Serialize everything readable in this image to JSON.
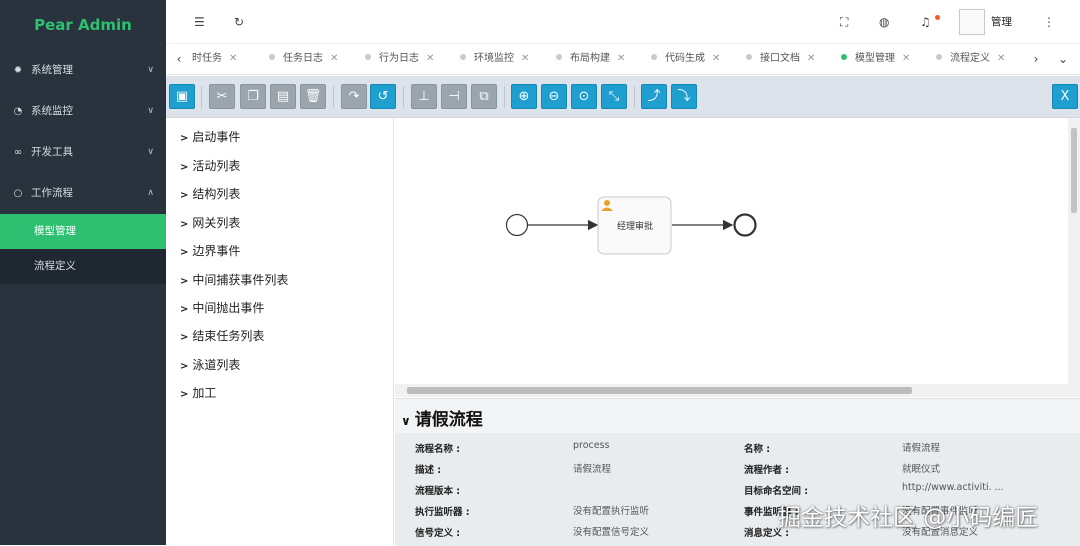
{
  "app": {
    "title": "Pear Admin",
    "accent": "#2fbf70",
    "sidebar_bg": "#28333e"
  },
  "sidebar": {
    "items": [
      {
        "label": "系统管理",
        "icon": "gear-icon",
        "expanded": false
      },
      {
        "label": "系统监控",
        "icon": "gauge-icon",
        "expanded": false
      },
      {
        "label": "开发工具",
        "icon": "link-icon",
        "expanded": false
      },
      {
        "label": "工作流程",
        "icon": "circle-icon",
        "expanded": true
      }
    ],
    "sub_items": [
      {
        "label": "模型管理",
        "active": true
      },
      {
        "label": "流程定义",
        "active": false
      }
    ]
  },
  "header": {
    "menu_icon": "menu-fold-icon",
    "refresh_icon": "refresh-icon",
    "fullscreen_icon": "fullscreen-icon",
    "globe_icon": "globe-icon",
    "bell_icon": "bell-icon",
    "user_name": "管理",
    "more_icon": "more-vertical-icon"
  },
  "tabs": [
    {
      "label": "时任务",
      "active": false
    },
    {
      "label": "任务日志",
      "active": false
    },
    {
      "label": "行为日志",
      "active": false
    },
    {
      "label": "环境监控",
      "active": false
    },
    {
      "label": "布局构建",
      "active": false
    },
    {
      "label": "代码生成",
      "active": false
    },
    {
      "label": "接口文档",
      "active": false
    },
    {
      "label": "模型管理",
      "active": true
    },
    {
      "label": "流程定义",
      "active": false
    }
  ],
  "toolbar": {
    "buttons": [
      "save",
      "cut",
      "copy",
      "paste",
      "delete",
      "redo",
      "undo",
      "align-vertical",
      "align-horizontal",
      "same-size",
      "zoom-in",
      "zoom-out",
      "zoom-actual",
      "zoom-fit",
      "bend-add",
      "bend-remove"
    ],
    "close_label": "X"
  },
  "palette": {
    "items": [
      "启动事件",
      "活动列表",
      "结构列表",
      "网关列表",
      "边界事件",
      "中间捕获事件列表",
      "中间抛出事件",
      "结束任务列表",
      "泳道列表",
      "加工"
    ]
  },
  "diagram": {
    "task_label": "经理审批",
    "task_icon": "user-icon"
  },
  "properties": {
    "title": "请假流程",
    "rows": [
      {
        "label": "流程名称 :",
        "value": "process"
      },
      {
        "label": "名称 :",
        "value": "请假流程"
      },
      {
        "label": "描述 :",
        "value": "请假流程"
      },
      {
        "label": "流程作者 :",
        "value": "就眠仪式"
      },
      {
        "label": "流程版本 :",
        "value": ""
      },
      {
        "label": "目标命名空间 :",
        "value": "http://www.activiti. ..."
      },
      {
        "label": "执行监听器 :",
        "value": "没有配置执行监听"
      },
      {
        "label": "事件监听器 :",
        "value": "没有配置事件监听"
      },
      {
        "label": "信号定义 :",
        "value": "没有配置信号定义"
      },
      {
        "label": "消息定义 :",
        "value": "没有配置消息定义"
      }
    ]
  },
  "watermark": "掘金技术社区 @小码编匠"
}
